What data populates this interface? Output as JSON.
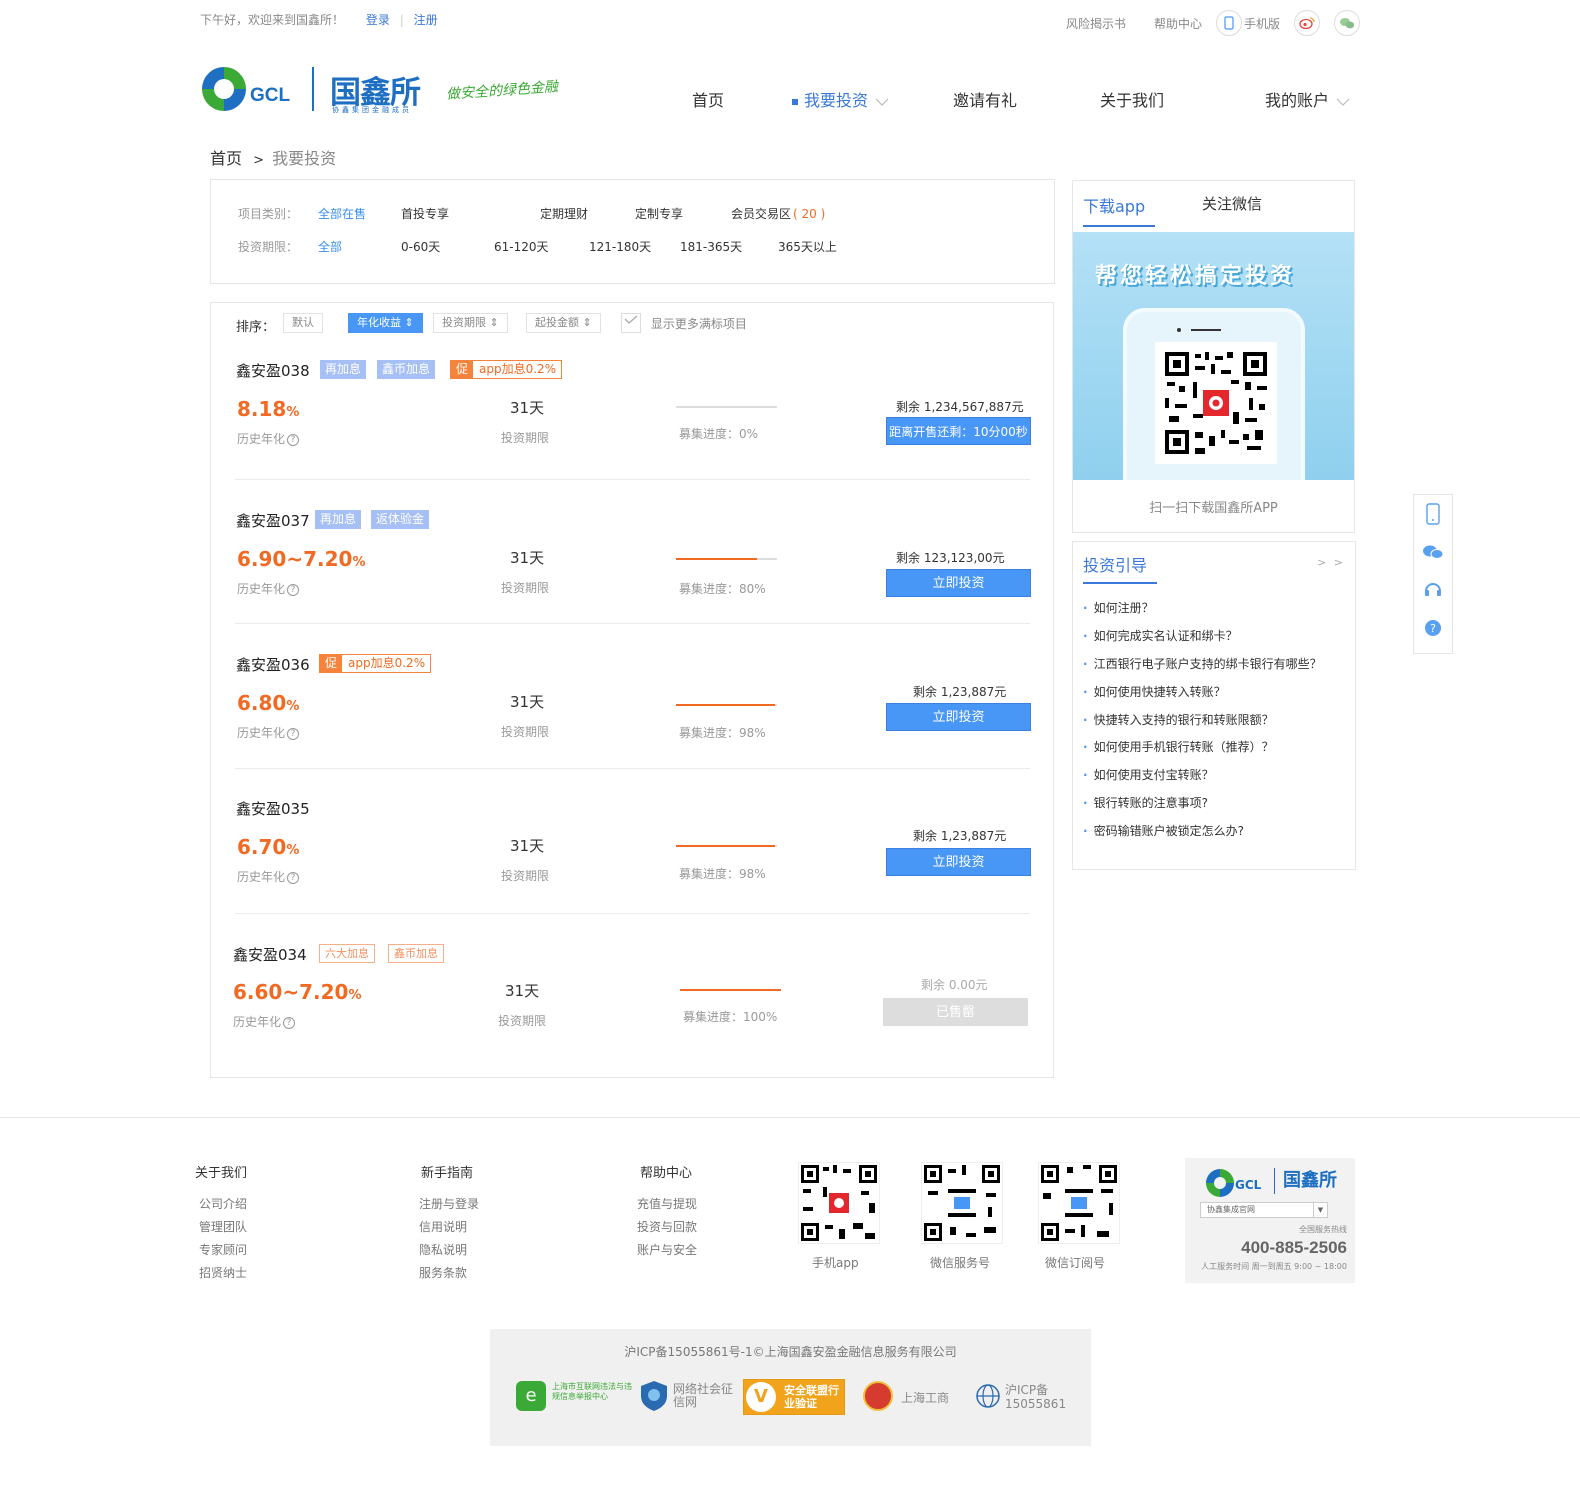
{
  "topbar": {
    "greeting": "下午好，欢迎来到国鑫所！",
    "login": "登录",
    "divider": "|",
    "register": "注册",
    "risk": "风险揭示书",
    "help": "帮助中心",
    "mobile": "手机版"
  },
  "header": {
    "logo_text": "GCL",
    "brand": "国鑫所",
    "brand_sub": "协鑫集团金融成员",
    "slogan": "做安全的绿色金融",
    "nav": [
      "首页",
      "我要投资",
      "邀请有礼",
      "关于我们",
      "我的账户"
    ]
  },
  "breadcrumb": {
    "home": "首页",
    "sep": ">",
    "current": "我要投资"
  },
  "filters": {
    "category_label": "项目类别：",
    "categories": [
      "全部在售",
      "首投专享",
      "定期理财",
      "定制专享",
      "会员交易区"
    ],
    "member_count": "( 20 )",
    "period_label": "投资期限：",
    "periods": [
      "全部",
      "0-60天",
      "61-120天",
      "121-180天",
      "181-365天",
      "365天以上"
    ]
  },
  "sort": {
    "label": "排序：",
    "options": [
      "默认",
      "年化收益",
      "投资期限",
      "起投金额"
    ],
    "show_full": "显示更多满标项目"
  },
  "products": [
    {
      "name": "鑫安盈038",
      "tags": [
        "再加息",
        "鑫币加息"
      ],
      "promo": "app加息0.2%",
      "rate": "8.18",
      "pct": "%",
      "rate_label": "历史年化",
      "days": "31天",
      "days_label": "投资期限",
      "progress_label": "募集进度：0%",
      "progress": 0.0,
      "remain": "剩余   1,234,567,887元",
      "button": "距离开售还剩：10分00秒"
    },
    {
      "name": "鑫安盈037",
      "tags": [
        "再加息",
        "返体验金"
      ],
      "promo": "",
      "rate": "6.90~7.20",
      "pct": "%",
      "rate_label": "历史年化",
      "days": "31天",
      "days_label": "投资期限",
      "progress_label": "募集进度：80%",
      "progress": 0.8,
      "remain": "剩余   123,123,00元",
      "button": "立即投资"
    },
    {
      "name": "鑫安盈036",
      "tags": [],
      "promo": "app加息0.2%",
      "rate": "6.80",
      "pct": "%",
      "rate_label": "历史年化",
      "days": "31天",
      "days_label": "投资期限",
      "progress_label": "募集进度：98%",
      "progress": 0.98,
      "remain": "剩余   1,23,887元",
      "button": "立即投资"
    },
    {
      "name": "鑫安盈035",
      "tags": [],
      "promo": "",
      "rate": "6.70",
      "pct": "%",
      "rate_label": "历史年化",
      "days": "31天",
      "days_label": "投资期限",
      "progress_label": "募集进度：98%",
      "progress": 0.98,
      "remain": "剩余   1,23,887元",
      "button": "立即投资"
    },
    {
      "name": "鑫安盈034",
      "tags": [
        "六大加息",
        "鑫币加息"
      ],
      "promo": "",
      "rate": "6.60~7.20",
      "pct": "%",
      "rate_label": "历史年化",
      "days": "31天",
      "days_label": "投资期限",
      "progress_label": "募集进度：100%",
      "progress": 1.0,
      "remain": "剩余   0.00元",
      "button": "已售罄"
    }
  ],
  "promo_badge": "促",
  "app_panel": {
    "tab_app": "下载app",
    "tab_wechat": "关注微信",
    "banner": "帮您轻松搞定投资",
    "caption": "扫一扫下载国鑫所APP"
  },
  "guide": {
    "title": "投资引导",
    "more": "> >",
    "items": [
      "如何注册？",
      "如何完成实名认证和绑卡？",
      "江西银行电子账户支持的绑卡银行有哪些？",
      "如何使用快捷转入转账？",
      "快捷转入支持的银行和转账限额？",
      "如何使用手机银行转账（推荐）？",
      "如何使用支付宝转账？",
      "银行转账的注意事项?",
      "密码输错账户被锁定怎么办?"
    ]
  },
  "footer": {
    "cols": [
      {
        "title": "关于我们",
        "links": [
          "公司介绍",
          "管理团队",
          "专家顾问",
          "招贤纳士"
        ]
      },
      {
        "title": "新手指南",
        "links": [
          "注册与登录",
          "信用说明",
          "隐私说明",
          "服务条款"
        ]
      },
      {
        "title": "帮助中心",
        "links": [
          "充值与提现",
          "投资与回款",
          "账户与安全"
        ]
      }
    ],
    "qrs": [
      "手机app",
      "微信服务号",
      "微信订阅号"
    ],
    "select": "协鑫集成官网",
    "hotline_label": "全国服务热线",
    "hotline": "400-885-2506",
    "hours": "人工服务时间  周一到周五  9:00 ~ 18:00",
    "icp": "沪ICP备15055861号-1©上海国鑫安盈金融信息服务有限公司",
    "badges": [
      "上海市互联网违法与违规信息举报中心",
      "网络社会征信网",
      "安全联盟行业验证",
      "上海工商",
      "沪ICP备15055861"
    ]
  },
  "colors": {
    "accent": "#4896f5",
    "orange": "#f06a23",
    "green": "#3aa935"
  }
}
